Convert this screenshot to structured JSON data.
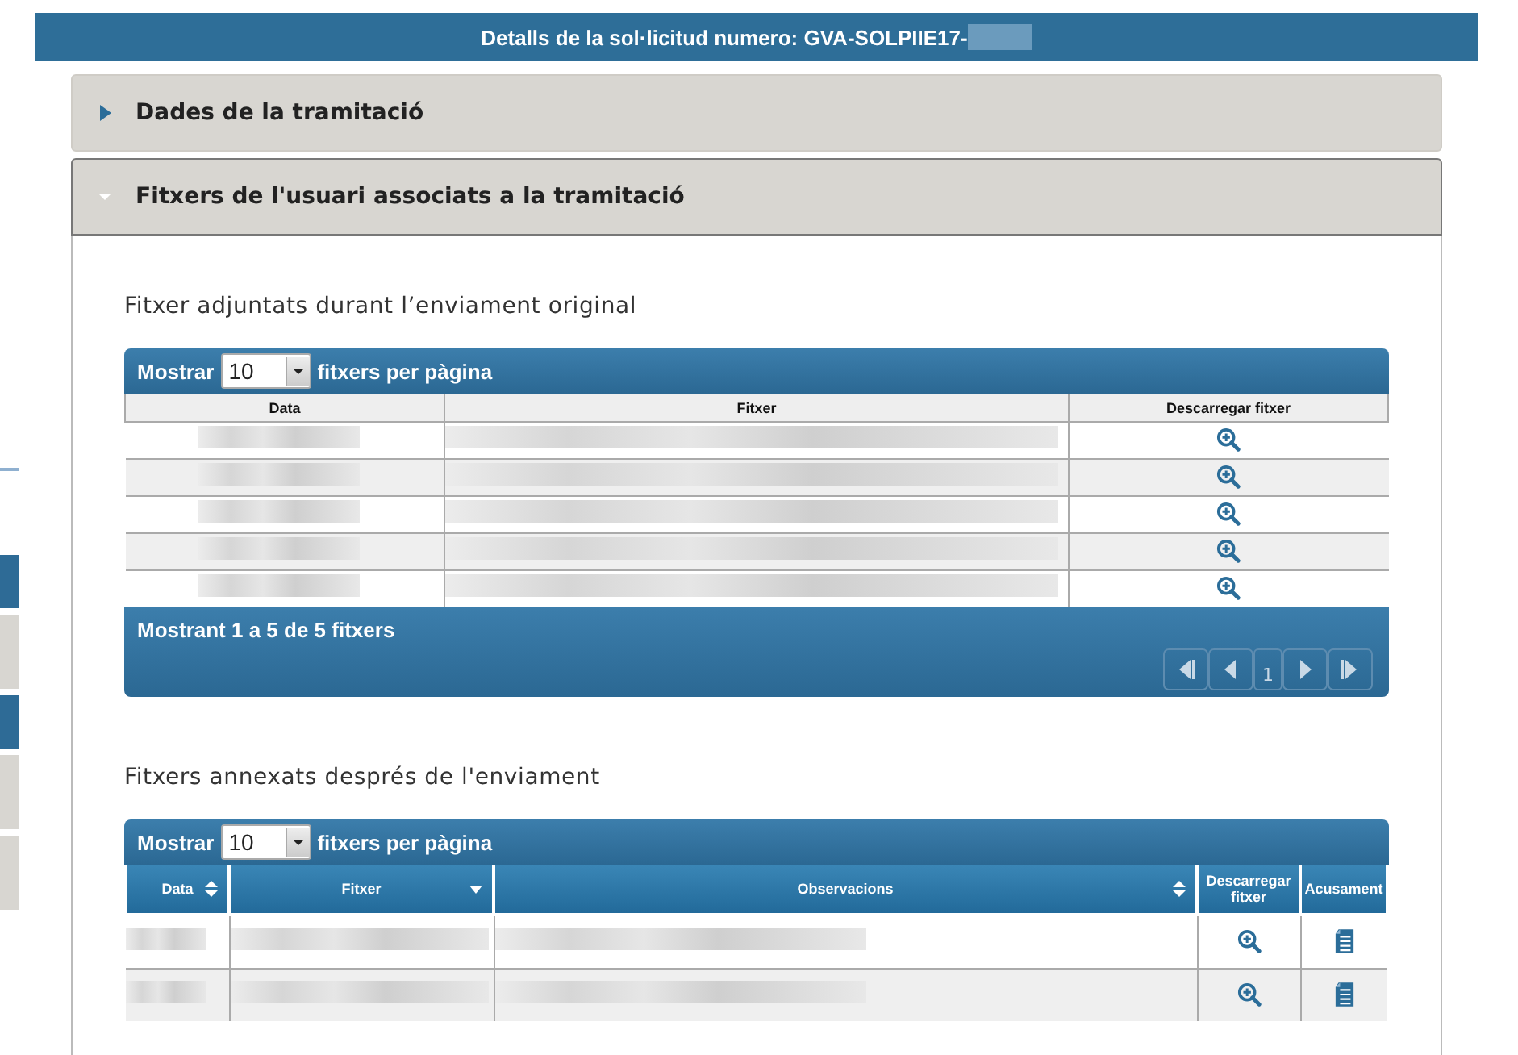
{
  "header": {
    "title": "Detalls de la sol·licitud numero: GVA-SOLPIIE17-"
  },
  "side_tabs": [
    {
      "selected": true
    },
    {
      "selected": false
    },
    {
      "selected": true
    },
    {
      "selected": false
    },
    {
      "selected": false
    }
  ],
  "sections": [
    {
      "title": "Dades de la tramitació",
      "expanded": false
    },
    {
      "title": "Fitxers de l'usuari associats a la tramitació",
      "expanded": true
    }
  ],
  "original_files": {
    "heading": "Fitxer adjuntats durant l’enviament original",
    "show_label": "Mostrar",
    "page_size": "10",
    "per_page_label": "fitxers per pàgina",
    "columns": [
      {
        "label": "Data",
        "sortable": false
      },
      {
        "label": "Fitxer",
        "sortable": false
      },
      {
        "label": "Descarregar fitxer",
        "sortable": false
      }
    ],
    "rows": [
      {
        "kind": "blurred"
      },
      {
        "kind": "blurred"
      },
      {
        "kind": "blurred"
      },
      {
        "kind": "blurred"
      },
      {
        "kind": "blurred"
      }
    ],
    "info": "Mostrant 1 a 5 de 5 fitxers",
    "current_page": "1"
  },
  "annexed_files": {
    "heading": "Fitxers annexats després de l'enviament",
    "show_label": "Mostrar",
    "page_size": "10",
    "per_page_label": "fitxers per pàgina",
    "columns": [
      {
        "label": "Data",
        "sortable": true
      },
      {
        "label": "Fitxer",
        "sortable": true
      },
      {
        "label": "Observacions",
        "sortable": true
      },
      {
        "label": "Descarregar fitxer",
        "sortable": false
      },
      {
        "label": "Acusament",
        "sortable": false
      }
    ],
    "rows": [
      {
        "kind": "blurred"
      },
      {
        "kind": "blurred"
      }
    ]
  }
}
